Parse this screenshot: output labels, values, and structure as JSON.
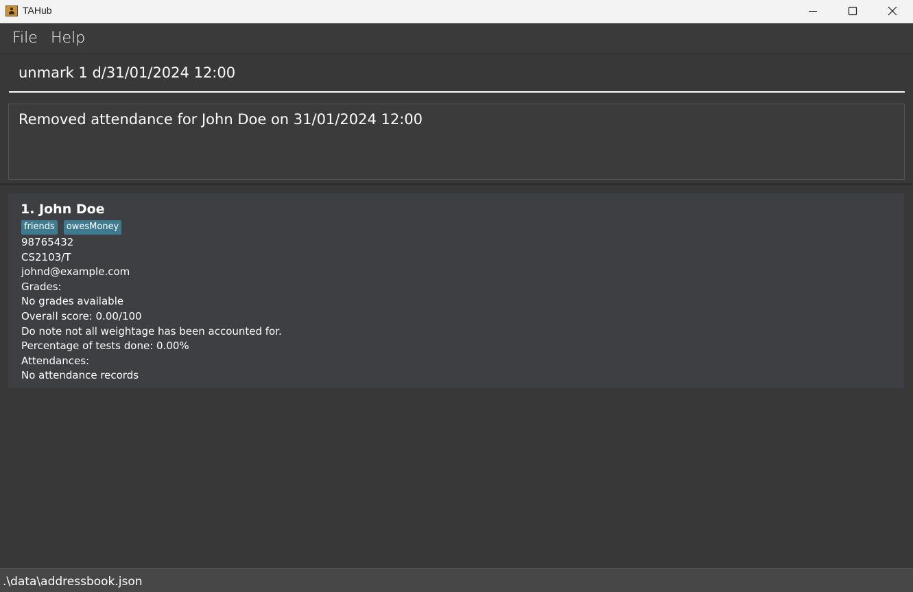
{
  "window": {
    "title": "TAHub"
  },
  "menu": {
    "file_label": "File",
    "help_label": "Help"
  },
  "command": {
    "value": "unmark 1 d/31/01/2024 12:00"
  },
  "result": {
    "message": "Removed attendance for John Doe on 31/01/2024 12:00"
  },
  "persons": [
    {
      "index_name": "1. John Doe",
      "tags": [
        "friends",
        "owesMoney"
      ],
      "phone": "98765432",
      "course": "CS2103/T",
      "email": "johnd@example.com",
      "grades_header": "Grades:",
      "grades_text": "No grades available",
      "overall_score": "Overall score: 0.00/100",
      "weightage_note": "Do note not all weightage has been accounted for.",
      "tests_done": "Percentage of tests done: 0.00%",
      "attendance_header": "Attendances:",
      "attendance_text": "No attendance records"
    }
  ],
  "status": {
    "file_path": ".\\data\\addressbook.json"
  },
  "colors": {
    "background": "#383838",
    "card": "#3e3f42",
    "tag": "#3e7b91",
    "titlebar": "#f3f3f3",
    "text": "#ffffff"
  },
  "icons": {
    "app": "address-book-icon",
    "minimize": "minimize-icon",
    "maximize": "maximize-icon",
    "close": "close-icon"
  }
}
